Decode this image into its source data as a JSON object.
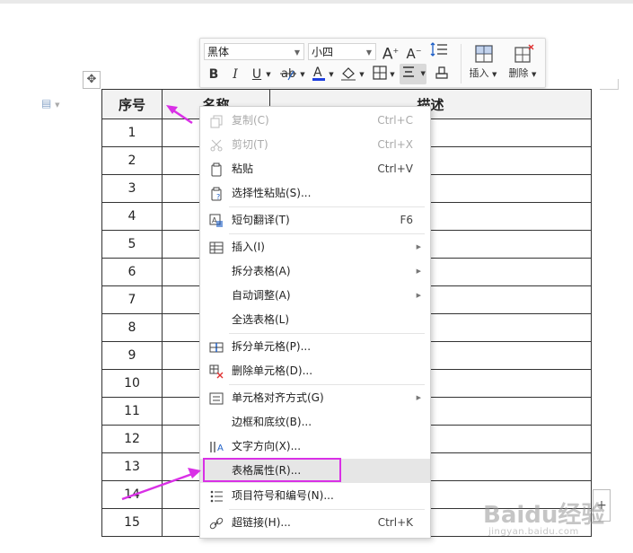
{
  "toolbar": {
    "font_name": "黑体",
    "font_size": "小四",
    "bold": "B",
    "italic": "I",
    "underline": "U",
    "insert_label": "插入",
    "delete_label": "删除"
  },
  "table": {
    "headers": [
      "序号",
      "名称",
      "描述"
    ],
    "rows": [
      "1",
      "2",
      "3",
      "4",
      "5",
      "6",
      "7",
      "8",
      "9",
      "10",
      "11",
      "12",
      "13",
      "14",
      "15"
    ]
  },
  "context_menu": {
    "copy": {
      "label": "复制(C)",
      "shortcut": "Ctrl+C"
    },
    "cut": {
      "label": "剪切(T)",
      "shortcut": "Ctrl+X"
    },
    "paste": {
      "label": "粘贴",
      "shortcut": "Ctrl+V"
    },
    "paste_special": {
      "label": "选择性粘贴(S)..."
    },
    "translate": {
      "label": "短句翻译(T)",
      "shortcut": "F6"
    },
    "insert": {
      "label": "插入(I)"
    },
    "split_table": {
      "label": "拆分表格(A)"
    },
    "auto_fit": {
      "label": "自动调整(A)"
    },
    "select_table": {
      "label": "全选表格(L)"
    },
    "split_cells": {
      "label": "拆分单元格(P)..."
    },
    "delete_cells": {
      "label": "删除单元格(D)..."
    },
    "cell_alignment": {
      "label": "单元格对齐方式(G)"
    },
    "borders_shading": {
      "label": "边框和底纹(B)..."
    },
    "text_direction": {
      "label": "文字方向(X)..."
    },
    "table_properties": {
      "label": "表格属性(R)..."
    },
    "bullets_numbering": {
      "label": "项目符号和编号(N)..."
    },
    "hyperlink": {
      "label": "超链接(H)...",
      "shortcut": "Ctrl+K"
    }
  },
  "watermark": {
    "text": "Baidu经验",
    "sub": "jingyan.baidu.com"
  },
  "colors": {
    "highlight": "#d930e6",
    "arrow": "#d930e6",
    "font_color_bar": "#1e3fe0"
  }
}
